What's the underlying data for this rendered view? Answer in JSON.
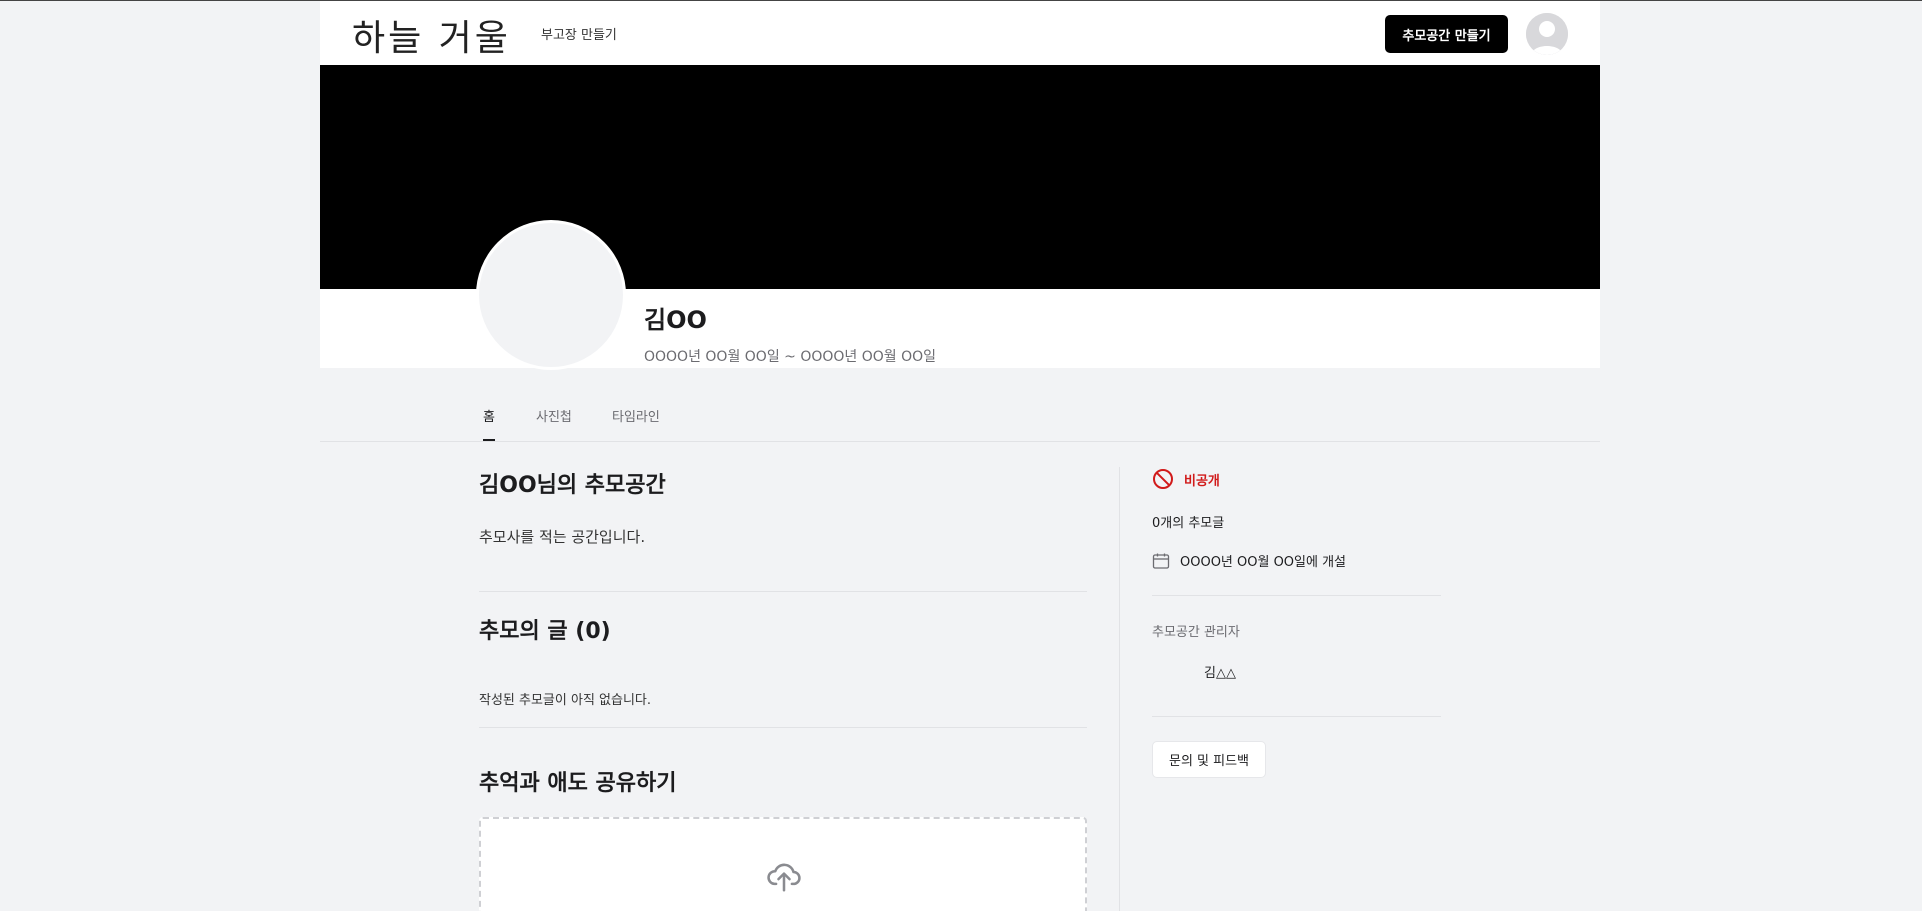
{
  "header": {
    "logo": "하늘 거울",
    "nav_link": "부고장 만들기",
    "create_button": "추모공간 만들기"
  },
  "profile": {
    "name": "김OO",
    "dates": "OOOO년 OO월 OO일 ~ OOOO년 OO월 OO일"
  },
  "tabs": [
    {
      "label": "홈",
      "active": true
    },
    {
      "label": "사진첩",
      "active": false
    },
    {
      "label": "타임라인",
      "active": false
    }
  ],
  "main": {
    "memorial_title": "김OO님의 추모공간",
    "memorial_desc": "추모사를 적는 공간입니다.",
    "posts_title": "추모의 글 (0)",
    "posts_empty": "작성된 추모글이 아직 없습니다.",
    "share_title": "추억과 애도 공유하기"
  },
  "sidebar": {
    "privacy": "비공개",
    "post_count": "0개의 추모글",
    "opened_date": "OOOO년 OO월 OO일에 개설",
    "admin_label": "추모공간 관리자",
    "admin_name": "김△△",
    "feedback_button": "문의 및 피드백"
  },
  "colors": {
    "page_bg": "#f2f3f5",
    "cover": "#000000",
    "private_red": "#d11a1a",
    "primary_button": "#000000"
  },
  "icons": {
    "privacy": "no-entry-icon",
    "calendar": "calendar-icon",
    "upload": "cloud-upload-icon",
    "avatar": "user-avatar-icon"
  }
}
